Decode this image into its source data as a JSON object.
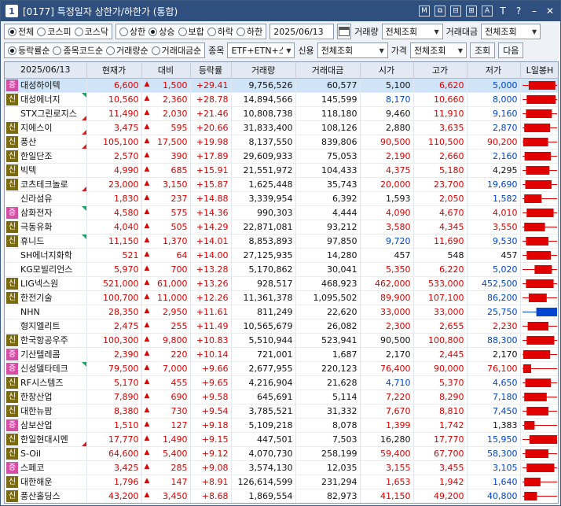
{
  "window": {
    "number": "1",
    "title": "[0177] 특정일자 상한가/하한가 (통합)",
    "tools": [
      "M",
      "⧉",
      "⊟",
      "⊞",
      "A",
      "T",
      "?",
      "–",
      "✕"
    ]
  },
  "filters_row1": {
    "market": [
      "전체",
      "코스피",
      "코스닥"
    ],
    "market_selected": 0,
    "direction": [
      "상한",
      "상승",
      "보합",
      "하락",
      "하한"
    ],
    "direction_selected": 1,
    "date": "2025/06/13",
    "volume_label": "거래량",
    "volume_value": "전체조회",
    "amount_label": "거래대금",
    "amount_value": "전체조회"
  },
  "filters_row2": {
    "sort": [
      "등락률순",
      "종목코드순",
      "거래량순",
      "거래대금순"
    ],
    "sort_selected": 0,
    "item_label": "종목",
    "item_value": "ETF+ETN+스팩",
    "credit_label": "신용",
    "credit_value": "전체조회",
    "price_label": "가격",
    "price_value": "전체조회",
    "query_button": "조회",
    "next_button": "다음"
  },
  "table": {
    "columns": [
      "2025/06/13",
      "현재가",
      "대비",
      "등락률",
      "거래량",
      "거래대금",
      "시가",
      "고가",
      "저가",
      "L일봉H"
    ],
    "rows": [
      {
        "badge": "증",
        "name": "대성하이텍",
        "price": "6,600",
        "diff": "1,500",
        "rate": "+29.41",
        "vol": "9,756,526",
        "amt": "60,577",
        "open": "5,100",
        "open_c": "eq",
        "high": "6,620",
        "high_c": "up",
        "low": "5,000",
        "low_c": "dn",
        "flag": "none",
        "candle": [
          0.18,
          0.95,
          0.0,
          1.0
        ]
      },
      {
        "badge": "신",
        "name": "대성에너지",
        "price": "10,560",
        "diff": "2,360",
        "rate": "+28.78",
        "vol": "14,894,566",
        "amt": "145,599",
        "open": "8,170",
        "open_c": "dn",
        "high": "10,660",
        "high_c": "up",
        "low": "8,000",
        "low_c": "dn",
        "flag": "green",
        "candle": [
          0.12,
          0.96,
          0.0,
          1.0
        ]
      },
      {
        "badge": "",
        "name": "STX그린로지스",
        "price": "11,490",
        "diff": "2,030",
        "rate": "+21.46",
        "vol": "10,808,738",
        "amt": "118,180",
        "open": "9,460",
        "open_c": "eq",
        "high": "11,910",
        "high_c": "up",
        "low": "9,160",
        "low_c": "dn",
        "flag": "red",
        "candle": [
          0.1,
          0.85,
          0.0,
          1.0
        ]
      },
      {
        "badge": "신",
        "name": "지에스이",
        "price": "3,475",
        "diff": "595",
        "rate": "+20.66",
        "vol": "31,833,400",
        "amt": "108,126",
        "open": "2,880",
        "open_c": "eq",
        "high": "3,635",
        "high_c": "up",
        "low": "2,870",
        "low_c": "dn",
        "flag": "red",
        "candle": [
          0.05,
          0.8,
          0.0,
          1.0
        ]
      },
      {
        "badge": "신",
        "name": "풍산",
        "price": "105,100",
        "diff": "17,500",
        "rate": "+19.98",
        "vol": "8,137,550",
        "amt": "839,806",
        "open": "90,500",
        "open_c": "up",
        "high": "110,500",
        "high_c": "up",
        "low": "90,200",
        "low_c": "up",
        "flag": "red",
        "candle": [
          0.02,
          0.74,
          0.0,
          1.0
        ]
      },
      {
        "badge": "신",
        "name": "한일단조",
        "price": "2,570",
        "diff": "390",
        "rate": "+17.89",
        "vol": "29,609,933",
        "amt": "75,053",
        "open": "2,190",
        "open_c": "up",
        "high": "2,660",
        "high_c": "up",
        "low": "2,160",
        "low_c": "dn",
        "flag": "none",
        "candle": [
          0.06,
          0.82,
          0.0,
          1.0
        ]
      },
      {
        "badge": "신",
        "name": "빅텍",
        "price": "4,990",
        "diff": "685",
        "rate": "+15.91",
        "vol": "21,551,972",
        "amt": "104,433",
        "open": "4,375",
        "open_c": "up",
        "high": "5,180",
        "high_c": "up",
        "low": "4,295",
        "low_c": "eq",
        "flag": "none",
        "candle": [
          0.1,
          0.78,
          0.0,
          1.0
        ]
      },
      {
        "badge": "신",
        "name": "코츠테크놀로",
        "price": "23,000",
        "diff": "3,150",
        "rate": "+15.87",
        "vol": "1,625,448",
        "amt": "35,743",
        "open": "20,000",
        "open_c": "up",
        "high": "23,700",
        "high_c": "up",
        "low": "19,690",
        "low_c": "dn",
        "flag": "red",
        "candle": [
          0.08,
          0.84,
          0.0,
          1.0
        ]
      },
      {
        "badge": "",
        "name": "신라섬유",
        "price": "1,830",
        "diff": "237",
        "rate": "+14.88",
        "vol": "3,339,954",
        "amt": "6,392",
        "open": "1,593",
        "open_c": "eq",
        "high": "2,050",
        "high_c": "up",
        "low": "1,582",
        "low_c": "dn",
        "flag": "none",
        "candle": [
          0.05,
          0.55,
          0.0,
          1.0
        ]
      },
      {
        "badge": "증",
        "name": "삼화전자",
        "price": "4,580",
        "diff": "575",
        "rate": "+14.36",
        "vol": "990,303",
        "amt": "4,444",
        "open": "4,090",
        "open_c": "up",
        "high": "4,670",
        "high_c": "up",
        "low": "4,010",
        "low_c": "up",
        "flag": "green",
        "candle": [
          0.12,
          0.9,
          0.0,
          1.0
        ]
      },
      {
        "badge": "신",
        "name": "극동유화",
        "price": "4,040",
        "diff": "505",
        "rate": "+14.29",
        "vol": "22,871,081",
        "amt": "93,212",
        "open": "3,580",
        "open_c": "up",
        "high": "4,345",
        "high_c": "up",
        "low": "3,550",
        "low_c": "up",
        "flag": "none",
        "candle": [
          0.05,
          0.65,
          0.0,
          1.0
        ]
      },
      {
        "badge": "신",
        "name": "휴니드",
        "price": "11,150",
        "diff": "1,370",
        "rate": "+14.01",
        "vol": "8,853,893",
        "amt": "97,850",
        "open": "9,720",
        "open_c": "dn",
        "high": "11,690",
        "high_c": "up",
        "low": "9,530",
        "low_c": "dn",
        "flag": "green",
        "candle": [
          0.1,
          0.75,
          0.0,
          1.0
        ]
      },
      {
        "badge": "",
        "name": "SH에너지화학",
        "price": "521",
        "diff": "64",
        "rate": "+14.00",
        "vol": "27,125,935",
        "amt": "14,280",
        "open": "457",
        "open_c": "eq",
        "high": "548",
        "high_c": "eq",
        "low": "457",
        "low_c": "eq",
        "flag": "none",
        "candle": [
          0.12,
          0.82,
          0.0,
          1.0
        ]
      },
      {
        "badge": "",
        "name": "KG모빌리언스",
        "price": "5,970",
        "diff": "700",
        "rate": "+13.28",
        "vol": "5,170,862",
        "amt": "30,041",
        "open": "5,350",
        "open_c": "up",
        "high": "6,220",
        "high_c": "up",
        "low": "5,020",
        "low_c": "dn",
        "flag": "none",
        "candle": [
          0.35,
          0.85,
          0.0,
          1.0
        ]
      },
      {
        "badge": "신",
        "name": "LIG넥스원",
        "price": "521,000",
        "diff": "61,000",
        "rate": "+13.26",
        "vol": "928,517",
        "amt": "468,923",
        "open": "462,000",
        "open_c": "up",
        "high": "533,000",
        "high_c": "up",
        "low": "452,500",
        "low_c": "dn",
        "flag": "none",
        "candle": [
          0.1,
          0.9,
          0.0,
          1.0
        ]
      },
      {
        "badge": "신",
        "name": "한전기술",
        "price": "100,700",
        "diff": "11,000",
        "rate": "+12.26",
        "vol": "11,361,378",
        "amt": "1,095,502",
        "open": "89,900",
        "open_c": "up",
        "high": "107,100",
        "high_c": "up",
        "low": "86,200",
        "low_c": "dn",
        "flag": "none",
        "candle": [
          0.18,
          0.7,
          0.0,
          1.0
        ]
      },
      {
        "badge": "",
        "name": "NHN",
        "price": "28,350",
        "diff": "2,950",
        "rate": "+11.61",
        "vol": "811,249",
        "amt": "22,620",
        "open": "33,000",
        "open_c": "up",
        "high": "33,000",
        "high_c": "up",
        "low": "25,750",
        "low_c": "dn",
        "flag": "none",
        "candle": [
          0.4,
          1.0,
          0.0,
          1.0
        ],
        "down": true
      },
      {
        "badge": "",
        "name": "형지엘리트",
        "price": "2,475",
        "diff": "255",
        "rate": "+11.49",
        "vol": "10,565,679",
        "amt": "26,082",
        "open": "2,300",
        "open_c": "up",
        "high": "2,655",
        "high_c": "up",
        "low": "2,230",
        "low_c": "up",
        "flag": "none",
        "candle": [
          0.15,
          0.75,
          0.0,
          1.0
        ]
      },
      {
        "badge": "신",
        "name": "한국항공우주",
        "price": "100,300",
        "diff": "9,800",
        "rate": "+10.83",
        "vol": "5,510,944",
        "amt": "523,941",
        "open": "90,500",
        "open_c": "eq",
        "high": "100,800",
        "high_c": "up",
        "low": "88,300",
        "low_c": "dn",
        "flag": "none",
        "candle": [
          0.12,
          0.92,
          0.0,
          1.0
        ]
      },
      {
        "badge": "증",
        "name": "기산텔레콤",
        "price": "2,390",
        "diff": "220",
        "rate": "+10.14",
        "vol": "721,001",
        "amt": "1,687",
        "open": "2,170",
        "open_c": "eq",
        "high": "2,445",
        "high_c": "up",
        "low": "2,170",
        "low_c": "eq",
        "flag": "none",
        "candle": [
          0.02,
          0.8,
          0.0,
          1.0
        ]
      },
      {
        "badge": "증",
        "name": "신성델타테크",
        "price": "79,500",
        "diff": "7,000",
        "rate": "+9.66",
        "vol": "2,677,955",
        "amt": "220,123",
        "open": "76,400",
        "open_c": "up",
        "high": "90,000",
        "high_c": "up",
        "low": "76,100",
        "low_c": "up",
        "flag": "green",
        "candle": [
          0.02,
          0.25,
          0.0,
          1.0
        ]
      },
      {
        "badge": "신",
        "name": "RF시스템즈",
        "price": "5,170",
        "diff": "455",
        "rate": "+9.65",
        "vol": "4,216,904",
        "amt": "21,628",
        "open": "4,710",
        "open_c": "dn",
        "high": "5,370",
        "high_c": "up",
        "low": "4,650",
        "low_c": "dn",
        "flag": "none",
        "candle": [
          0.08,
          0.82,
          0.0,
          1.0
        ]
      },
      {
        "badge": "신",
        "name": "한창산업",
        "price": "7,890",
        "diff": "690",
        "rate": "+9.58",
        "vol": "645,691",
        "amt": "5,114",
        "open": "7,220",
        "open_c": "up",
        "high": "8,290",
        "high_c": "up",
        "low": "7,180",
        "low_c": "dn",
        "flag": "none",
        "candle": [
          0.05,
          0.7,
          0.0,
          1.0
        ]
      },
      {
        "badge": "신",
        "name": "대한뉴팜",
        "price": "8,380",
        "diff": "730",
        "rate": "+9.54",
        "vol": "3,785,521",
        "amt": "31,332",
        "open": "7,670",
        "open_c": "up",
        "high": "8,810",
        "high_c": "up",
        "low": "7,450",
        "low_c": "dn",
        "flag": "none",
        "candle": [
          0.12,
          0.75,
          0.0,
          1.0
        ]
      },
      {
        "badge": "증",
        "name": "삼보산업",
        "price": "1,510",
        "diff": "127",
        "rate": "+9.18",
        "vol": "5,109,218",
        "amt": "8,078",
        "open": "1,399",
        "open_c": "up",
        "high": "1,742",
        "high_c": "up",
        "low": "1,383",
        "low_c": "eq",
        "flag": "none",
        "candle": [
          0.05,
          0.35,
          0.0,
          1.0
        ]
      },
      {
        "badge": "신",
        "name": "한일현대시멘",
        "price": "17,770",
        "diff": "1,490",
        "rate": "+9.15",
        "vol": "447,501",
        "amt": "7,503",
        "open": "16,280",
        "open_c": "eq",
        "high": "17,770",
        "high_c": "up",
        "low": "15,950",
        "low_c": "dn",
        "flag": "red",
        "candle": [
          0.2,
          1.0,
          0.0,
          1.0
        ]
      },
      {
        "badge": "신",
        "name": "S-Oil",
        "price": "64,600",
        "diff": "5,400",
        "rate": "+9.12",
        "vol": "4,070,730",
        "amt": "258,199",
        "open": "59,400",
        "open_c": "up",
        "high": "67,700",
        "high_c": "up",
        "low": "58,300",
        "low_c": "dn",
        "flag": "none",
        "candle": [
          0.08,
          0.75,
          0.0,
          1.0
        ]
      },
      {
        "badge": "증",
        "name": "스페코",
        "price": "3,425",
        "diff": "285",
        "rate": "+9.08",
        "vol": "3,574,130",
        "amt": "12,035",
        "open": "3,155",
        "open_c": "up",
        "high": "3,455",
        "high_c": "up",
        "low": "3,105",
        "low_c": "dn",
        "flag": "none",
        "candle": [
          0.12,
          0.92,
          0.0,
          1.0
        ]
      },
      {
        "badge": "신",
        "name": "대한해운",
        "price": "1,796",
        "diff": "147",
        "rate": "+8.91",
        "vol": "126,614,599",
        "amt": "231,294",
        "open": "1,653",
        "open_c": "up",
        "high": "1,942",
        "high_c": "up",
        "low": "1,640",
        "low_c": "dn",
        "flag": "none",
        "candle": [
          0.05,
          0.52,
          0.0,
          1.0
        ]
      },
      {
        "badge": "신",
        "name": "풍산홀딩스",
        "price": "43,200",
        "diff": "3,450",
        "rate": "+8.68",
        "vol": "1,869,554",
        "amt": "82,973",
        "open": "41,150",
        "open_c": "up",
        "high": "49,200",
        "high_c": "up",
        "low": "40,800",
        "low_c": "dn",
        "flag": "none",
        "candle": [
          0.05,
          0.42,
          0.0,
          1.0
        ]
      }
    ]
  },
  "colors": {
    "up": "#e00000",
    "down": "#0044d0",
    "titlebar": "#2f4f7e",
    "selected_row": "#cfe4f7"
  }
}
